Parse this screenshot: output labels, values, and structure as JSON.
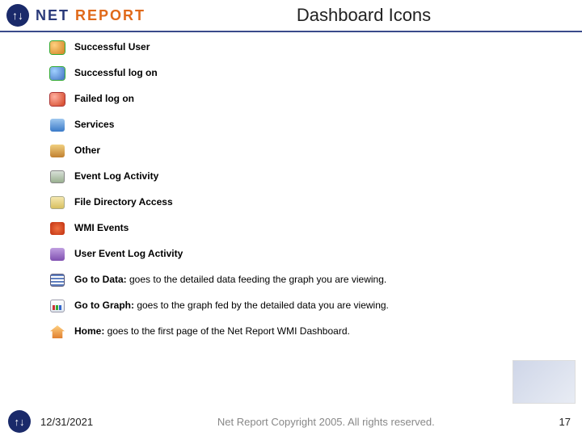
{
  "header": {
    "logo_prefix": "NET ",
    "logo_suffix": "REPORT",
    "title": "Dashboard Icons"
  },
  "items": [
    {
      "label": "Successful User",
      "desc": ""
    },
    {
      "label": "Successful log on",
      "desc": ""
    },
    {
      "label": "Failed log on",
      "desc": ""
    },
    {
      "label": "Services",
      "desc": ""
    },
    {
      "label": "Other",
      "desc": ""
    },
    {
      "label": "Event Log Activity",
      "desc": ""
    },
    {
      "label": "File Directory Access",
      "desc": ""
    },
    {
      "label": "WMI Events",
      "desc": ""
    },
    {
      "label": "User Event Log Activity",
      "desc": ""
    },
    {
      "label": "Go to Data: ",
      "desc": "goes to the detailed data feeding the graph you are viewing."
    },
    {
      "label": "Go to Graph: ",
      "desc": "goes to the graph fed by the detailed data you are viewing."
    },
    {
      "label": "Home: ",
      "desc": "goes to the first page of the Net Report WMI Dashboard."
    }
  ],
  "footer": {
    "date": "12/31/2021",
    "copyright": "Net Report Copyright 2005. All rights reserved.",
    "page": "17"
  }
}
